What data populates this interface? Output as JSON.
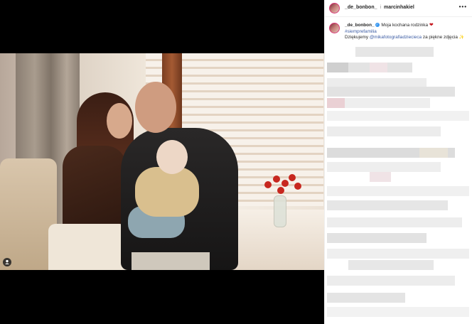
{
  "post": {
    "author": "_de_bonbon_",
    "collaborator": "marcinhakiel",
    "caption_text": "Moja kochana rodzinka",
    "hashtag": "#siemprefamilia",
    "thanks_prefix": "Dziękujemy",
    "mention": "@mikafotografiadziecieca",
    "thanks_suffix": "za piękne zdjęcia",
    "more_label": "•••",
    "header_separator": "i"
  },
  "icons": {
    "verified": "verified-badge-icon",
    "heart": "red-heart-emoji",
    "sparkle": "sparkles-emoji",
    "stories": "user-tag-icon"
  },
  "colors": {
    "link": "#3c5ca4",
    "verified": "#3897f0",
    "heart": "#c5181f"
  }
}
